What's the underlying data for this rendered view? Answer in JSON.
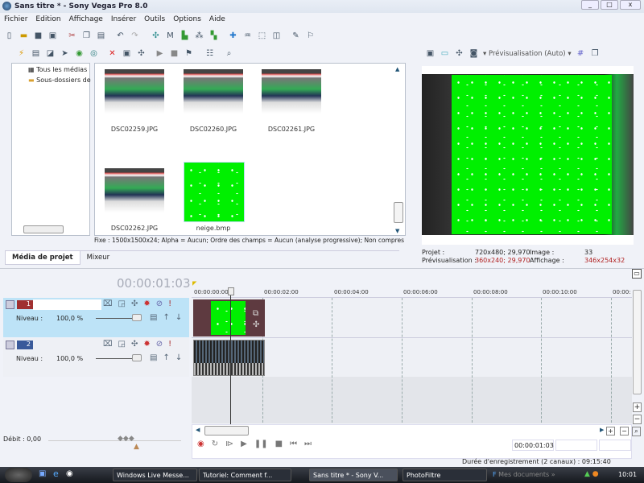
{
  "window": {
    "title": "Sans titre * - Sony Vegas Pro 8.0",
    "minimize": "_",
    "maximize": "□",
    "close": "x"
  },
  "menu": [
    "Fichier",
    "Edition",
    "Affichage",
    "Insérer",
    "Outils",
    "Options",
    "Aide"
  ],
  "toolbar_icons": [
    "new-icon",
    "open-icon",
    "save-icon",
    "properties-icon",
    "cut-icon",
    "copy-icon",
    "paste-icon",
    "undo-icon",
    "redo-icon",
    "auto-ripple-icon",
    "snap-icon",
    "quantize-icon",
    "normal-edit-tool-icon",
    "envelope-tool-icon",
    "selection-tool-icon",
    "zoom-tool-icon",
    "lock-icon",
    "ignore-grouping-icon"
  ],
  "media": {
    "tree": [
      "Tous les médias",
      "Sous-dossiers de"
    ],
    "files": [
      "DSC02259.JPG",
      "DSC02260.JPG",
      "DSC02261.JPG",
      "DSC02262.JPG",
      "neige.bmp"
    ],
    "selected": "neige.bmp",
    "status": "Fixe : 1500x1500x24; Alpha = Aucun; Ordre des champs = Aucun (analyse progressive); Non compres",
    "tabs": [
      "Média de projet",
      "Mixeur"
    ],
    "active_tab": "Média de projet"
  },
  "preview": {
    "mode": "Prévisualisation (Auto)",
    "projet_label": "Projet :",
    "projet_value": "720x480; 29,970",
    "image_label": "Image :",
    "image_value": "33",
    "previsualisation_label": "Prévisualisation :",
    "previsualisation_value": "360x240; 29,970",
    "affichage_label": "Affichage :",
    "affichage_value": "346x254x32",
    "highlight_color": "#b02020"
  },
  "timeline": {
    "current_time": "00:00:01:03",
    "ruler": [
      "00:00:00:00",
      "00:00:02:00",
      "00:00:04:00",
      "00:00:06:00",
      "00:00:08:00",
      "00:00:10:00",
      "00:00:"
    ],
    "tracks": [
      {
        "number": "1",
        "level_label": "Niveau :",
        "level": "100,0 %",
        "color": "#a03030",
        "selected": true
      },
      {
        "number": "2",
        "level_label": "Niveau :",
        "level": "100,0 %",
        "color": "#3a5a9a",
        "selected": false
      }
    ],
    "rate": "Débit : 0,00",
    "transport_time": "00:00:01:03"
  },
  "statusbar": {
    "recording": "Durée d'enregistrement (2 canaux) : 09:15:40"
  },
  "taskbar": {
    "tasks": [
      "Windows Live Messe...",
      "Tutoriel: Comment f...",
      "Sans titre * - Sony V...",
      "PhotoFiltre"
    ],
    "active": "Sans titre * - Sony V...",
    "toolbar_label": "Mes documents",
    "clock": "10:01"
  }
}
